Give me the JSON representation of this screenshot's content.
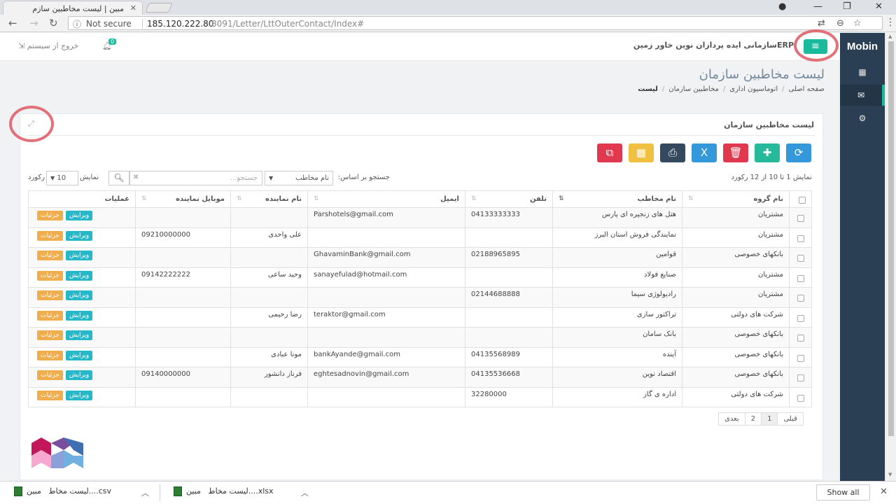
{
  "browser": {
    "tab_title": "مبین | لیست مخاطبین سازم",
    "secure_label": "Not secure",
    "url_host": "185.120.222.80",
    "url_path": ":8091/Letter/LttOuterContact/Index#"
  },
  "header": {
    "logout_label": "خروج از سیستم",
    "bell_count": "0",
    "org_name": "ERPسازمانی ایده پردازان نوین خاور زمین"
  },
  "sidebar": {
    "brand": "Mobin"
  },
  "page": {
    "title": "لیست مخاطبین سازمان",
    "breadcrumb": [
      "صفحه اصلی",
      "اتوماسیون اداری",
      "مخاطبین سازمان",
      "لیست"
    ]
  },
  "panel": {
    "title": "لیست مخاطبین سازمان",
    "search_by_label": "جستجو بر اساس:",
    "search_by_value": "نام مخاطب",
    "search_placeholder": "جستجو...",
    "show_label": "نمایش",
    "page_size": "10",
    "record_label": "رکورد",
    "info_text": "نمایش 1 تا 10 از 12 رکورد"
  },
  "table": {
    "headers": [
      "نام گروه",
      "نام مخاطب",
      "تلفن",
      "ایمیل",
      "نام نماینده",
      "موبایل نماینده",
      "عملیات"
    ],
    "edit_label": "ویرایش",
    "detail_label": "جزئیات",
    "rows": [
      {
        "group": "مشتریان",
        "name": "هتل های زنجیره ای پارس",
        "phone": "04133333333",
        "email": "Parshotels@gmail.com",
        "rep": "",
        "mobile": ""
      },
      {
        "group": "مشتریان",
        "name": "نمایندگی فروش استان البرز",
        "phone": "",
        "email": "",
        "rep": "علی واحدی",
        "mobile": "09210000000"
      },
      {
        "group": "بانکهای خصوصی",
        "name": "قوامین",
        "phone": "02188965895",
        "email": "GhavaminBank@gmail.com",
        "rep": "",
        "mobile": ""
      },
      {
        "group": "مشتریان",
        "name": "صنایع فولاد",
        "phone": "",
        "email": "sanayefulad@hotmail.com",
        "rep": "وحید ساعی",
        "mobile": "09142222222"
      },
      {
        "group": "مشتریان",
        "name": "رادیولوژی سیما",
        "phone": "02144688888",
        "email": "",
        "rep": "",
        "mobile": ""
      },
      {
        "group": "شرکت های دولتی",
        "name": "تراکتور سازی",
        "phone": "",
        "email": "teraktor@gmail.com",
        "rep": "رضا رحیمی",
        "mobile": ""
      },
      {
        "group": "بانکهای خصوصی",
        "name": "بانک سامان",
        "phone": "",
        "email": "",
        "rep": "",
        "mobile": ""
      },
      {
        "group": "بانکهای خصوصی",
        "name": "آینده",
        "phone": "04135568989",
        "email": "bankAyande@gmail.com",
        "rep": "مونا عبادی",
        "mobile": ""
      },
      {
        "group": "بانکهای خصوصی",
        "name": "اقتصاد نوین",
        "phone": "04135536668",
        "email": "eghtesadnovin@gmail.com",
        "rep": "فرناز دانشور",
        "mobile": "09140000000"
      },
      {
        "group": "شرکت های دولتی",
        "name": "اداره ی گاز",
        "phone": "32280000",
        "email": "",
        "rep": "",
        "mobile": ""
      }
    ]
  },
  "pager": {
    "prev": "قبلی",
    "p1": "1",
    "p2": "2",
    "next": "بعدی"
  },
  "downloads": {
    "item1_name": "مبین....csv",
    "item1_prefix": "لیست مخاط",
    "item2_name": "مبین....xlsx",
    "item2_prefix": "لیست مخاط",
    "show_all": "Show all"
  },
  "colors": {
    "accent": "#1abb9c",
    "sidebar": "#2a3f54",
    "highlight": "#e0626c"
  }
}
